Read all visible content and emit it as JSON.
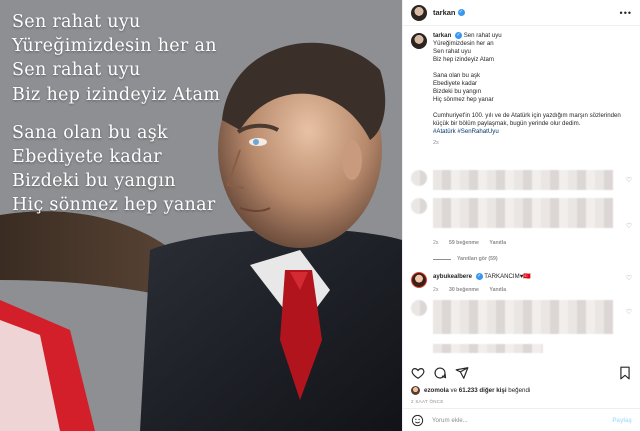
{
  "photo": {
    "poem": [
      "Sen rahat uyu",
      "Yüreğimizdesin her an",
      "Sen rahat uyu",
      "Biz hep izindeyiz Atam",
      "",
      "Sana olan bu aşk",
      "Ebediyete kadar",
      "Bizdeki bu yangın",
      "Hiç sönmez hep yanar"
    ]
  },
  "header": {
    "username": "tarkan",
    "more": "•••"
  },
  "caption": {
    "username": "tarkan",
    "lines": [
      "Sen rahat uyu",
      "Yüreğimizdesin her an",
      "Sen rahat uyu",
      "Biz hep izindeyiz Atam"
    ],
    "lines2": [
      "Sana olan bu aşk",
      "Ebediyete kadar",
      "Bizdeki bu yangın",
      "Hiç sönmez hep yanar"
    ],
    "paragraph": "Cumhuriyet'in 100. yılı ve de Atatürk için yazdığım marşın sözlerinden küçük bir bölüm paylaşmak, bugün yerinde olur dedim.",
    "hashtags": "#Atatürk #SenRahatUyu",
    "age": "2s"
  },
  "comments": {
    "c2": {
      "age": "2s",
      "likes": "59 beğenme",
      "reply": "Yanıtla",
      "view_replies": "Yanıtları gör (59)"
    },
    "c3": {
      "username": "aybukealbere",
      "text": "TARKANCIM♥🇹🇷",
      "age": "2s",
      "likes": "30 beğenme",
      "reply": "Yanıtla"
    }
  },
  "likes": {
    "user": "ezomola",
    "middle": " ve ",
    "count": "61.233 diğer kişi",
    "suffix": " beğendi"
  },
  "timestamp": "2 SAAT ÖNCE",
  "add_comment": {
    "placeholder": "Yorum ekle...",
    "post": "Paylaş"
  }
}
